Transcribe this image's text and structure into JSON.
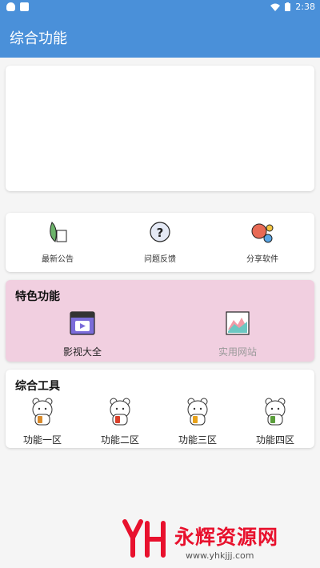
{
  "status_bar": {
    "time": "2:38"
  },
  "app_bar": {
    "title": "综合功能"
  },
  "quick_actions": [
    {
      "label": "最新公告",
      "icon": "leaf-note-icon"
    },
    {
      "label": "问题反馈",
      "icon": "question-bubble-icon"
    },
    {
      "label": "分享软件",
      "icon": "share-bubbles-icon"
    }
  ],
  "features": {
    "title": "特色功能",
    "items": [
      {
        "label": "影视大全",
        "icon": "video-player-icon",
        "color": "#222222"
      },
      {
        "label": "实用网站",
        "icon": "website-chart-icon",
        "color": "#9a9a9a"
      }
    ]
  },
  "tools": {
    "title": "综合工具",
    "items": [
      {
        "label": "功能一区",
        "icon": "bear-icon"
      },
      {
        "label": "功能二区",
        "icon": "bear-icon"
      },
      {
        "label": "功能三区",
        "icon": "bear-icon"
      },
      {
        "label": "功能四区",
        "icon": "bear-icon"
      }
    ]
  },
  "watermark": {
    "name": "永辉资源网",
    "url": "www.yhkjjj.com"
  },
  "colors": {
    "primary": "#4a90d9",
    "feature_bg": "#f1cfe0",
    "watermark_red": "#e8112d"
  }
}
